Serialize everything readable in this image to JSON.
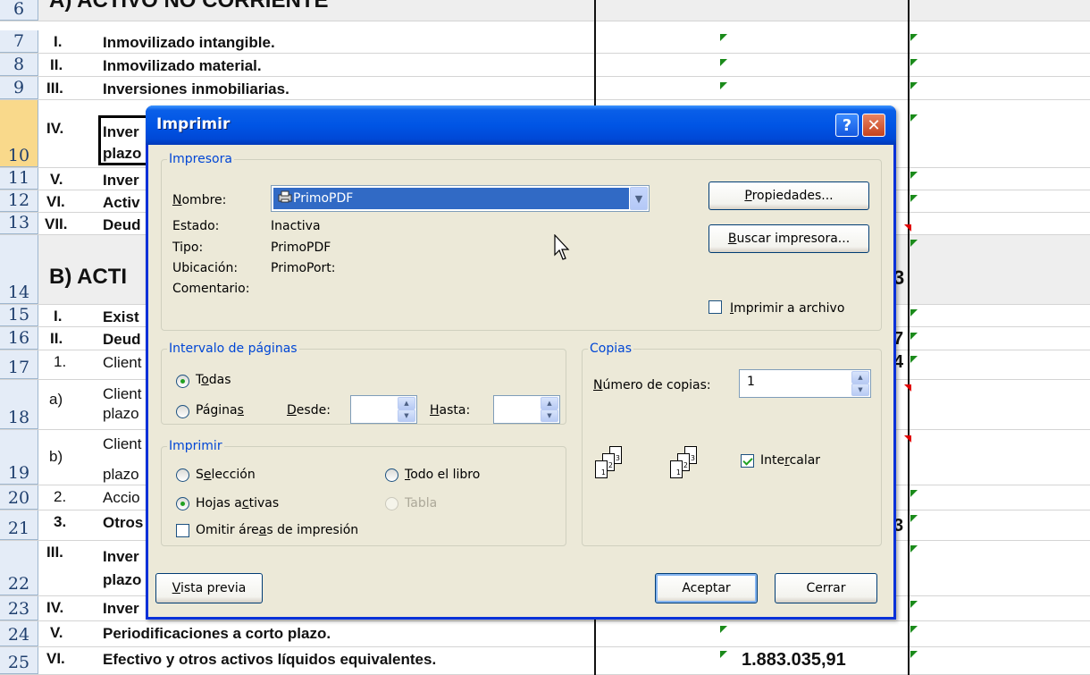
{
  "sheet": {
    "rows": [
      {
        "num": "6",
        "roman": "A)",
        "label": "ACTIVO NO CORRIENTE"
      },
      {
        "num": "7",
        "roman": "I.",
        "label": "Inmovilizado intangible."
      },
      {
        "num": "8",
        "roman": "II.",
        "label": "Inmovilizado material."
      },
      {
        "num": "9",
        "roman": "III.",
        "label": "Inversiones inmobiliarias."
      },
      {
        "num": "10",
        "roman": "IV.",
        "label": "Inver",
        "label2": "plazo"
      },
      {
        "num": "11",
        "roman": "V.",
        "label": "Inver"
      },
      {
        "num": "12",
        "roman": "VI.",
        "label": "Activ"
      },
      {
        "num": "13",
        "roman": "VII.",
        "label": "Deud"
      },
      {
        "num": "14",
        "roman": "",
        "label": "B) ACTI"
      },
      {
        "num": "15",
        "roman": "I.",
        "label": "Exist"
      },
      {
        "num": "16",
        "roman": "II.",
        "label": "Deud"
      },
      {
        "num": "17",
        "roman": "1.",
        "label": "Client"
      },
      {
        "num": "18",
        "roman": "a)",
        "label": "Client",
        "label2": "plazo"
      },
      {
        "num": "19",
        "roman": "b)",
        "label": "Client",
        "label2": "plazo"
      },
      {
        "num": "20",
        "roman": "2.",
        "label": "Accio"
      },
      {
        "num": "21",
        "roman": "3.",
        "label": "Otros"
      },
      {
        "num": "22",
        "roman": "III.",
        "label": "Inver",
        "label2": "plazo"
      },
      {
        "num": "23",
        "roman": "IV.",
        "label": "Inver"
      },
      {
        "num": "24",
        "roman": "V.",
        "label": "Periodificaciones a corto plazo."
      },
      {
        "num": "25",
        "roman": "VI.",
        "label": "Efectivo y otros activos líquidos equivalentes."
      }
    ],
    "right_digits": {
      "row14": "3",
      "row16": "7",
      "row17": "4",
      "row21": "3"
    },
    "amount_row25": "1.883.035,91"
  },
  "dialog": {
    "title": "Imprimir",
    "help_glyph": "?",
    "close_glyph": "✕",
    "printer": {
      "legend": "Impresora",
      "name_label": "Nombre:",
      "name_value": "PrimoPDF",
      "status_label": "Estado:",
      "status_value": "Inactiva",
      "type_label": "Tipo:",
      "type_value": "PrimoPDF",
      "location_label": "Ubicación:",
      "location_value": "PrimoPort:",
      "comment_label": "Comentario:",
      "properties_button": "Propiedades...",
      "find_printer_button": "Buscar impresora...",
      "print_to_file": "Imprimir a archivo",
      "print_to_file_checked": false
    },
    "range": {
      "legend": "Intervalo de páginas",
      "all": "Todas",
      "pages": "Páginas",
      "from_label": "Desde:",
      "from_value": "",
      "to_label": "Hasta:",
      "to_value": "",
      "selected": "all"
    },
    "print_what": {
      "legend": "Imprimir",
      "selection": "Selección",
      "whole_book": "Todo el libro",
      "active_sheets": "Hojas activas",
      "table": "Tabla",
      "selected": "active_sheets",
      "ignore_print_areas": "Omitir áreas de impresión",
      "ignore_print_areas_checked": false
    },
    "copies": {
      "legend": "Copias",
      "count_label": "Número de copias:",
      "count_value": "1",
      "collate": "Intercalar",
      "collate_checked": true
    },
    "preview_button": "Vista previa",
    "ok_button": "Aceptar",
    "cancel_button": "Cerrar"
  },
  "colors": {
    "title_bar": "#0055e5",
    "dialog_bg": "#ece9d8",
    "legend_text": "#0046d5",
    "row_header_bg": "#e4ecf7",
    "selected_row_header": "#f9d98b"
  },
  "icons": [
    "printer-icon",
    "chevron-down-icon",
    "mouse-cursor-icon",
    "collate-pages-icon"
  ]
}
